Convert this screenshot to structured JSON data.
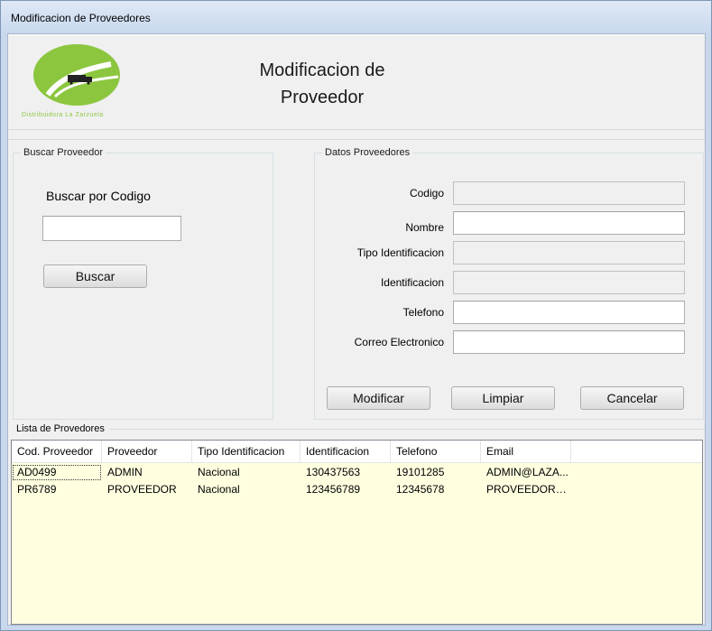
{
  "window": {
    "title": "Modificacion de Proveedores"
  },
  "header": {
    "title_line1": "Modificacion de",
    "title_line2": "Proveedor",
    "logo_text": "Distribuidora La Zarzuela"
  },
  "search": {
    "group_label": "Buscar Proveedor",
    "prompt": "Buscar por Codigo",
    "input_value": "",
    "button_label": "Buscar"
  },
  "details": {
    "group_label": "Datos Proveedores",
    "fields": [
      {
        "label": "Codigo",
        "value": "",
        "enabled": false
      },
      {
        "label": "Nombre",
        "value": "",
        "enabled": true
      },
      {
        "label": "Tipo Identificacion",
        "value": "",
        "enabled": false
      },
      {
        "label": "Identificacion",
        "value": "",
        "enabled": false
      },
      {
        "label": "Telefono",
        "value": "",
        "enabled": true
      },
      {
        "label": "Correo Electronico",
        "value": "",
        "enabled": true
      }
    ],
    "buttons": {
      "modify": "Modificar",
      "clear": "Limpiar",
      "cancel": "Cancelar"
    }
  },
  "list": {
    "group_label": "Lista de Provedores",
    "columns": [
      "Cod. Proveedor",
      "Proveedor",
      "Tipo Identificacion",
      "Identificacion",
      "Telefono",
      "Email"
    ],
    "rows": [
      [
        "AD0499",
        "ADMIN",
        "Nacional",
        "130437563",
        "19101285",
        "ADMIN@LAZA..."
      ],
      [
        "PR6789",
        "PROVEEDOR",
        "Nacional",
        "123456789",
        "12345678",
        "PROVEEDOR@..."
      ]
    ]
  },
  "colors": {
    "logo_green": "#8cc63f",
    "grid_background": "#ffffe0"
  }
}
